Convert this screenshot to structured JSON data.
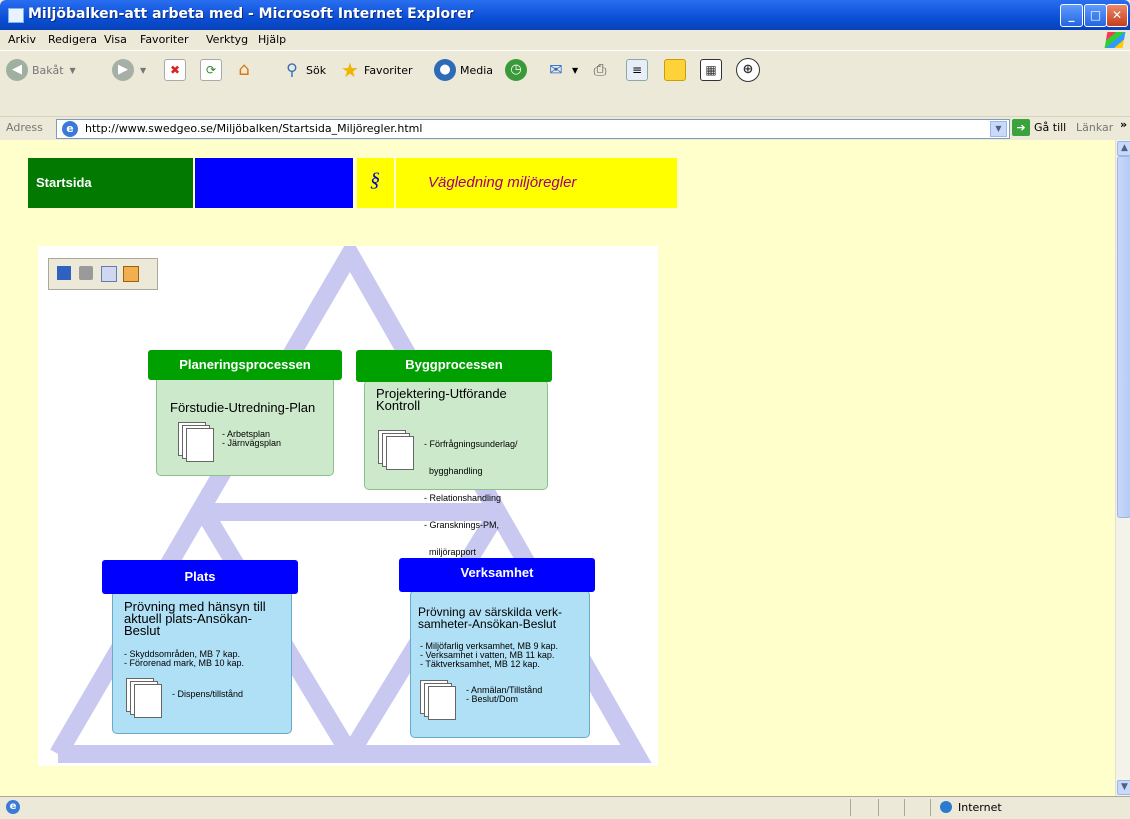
{
  "window": {
    "title": "Miljöbalken-att arbeta med - Microsoft Internet Explorer"
  },
  "menu": [
    "Arkiv",
    "Redigera",
    "Visa",
    "Favoriter",
    "Verktyg",
    "Hjälp"
  ],
  "toolbar": {
    "back": "Bakåt",
    "search": "Sök",
    "favorites": "Favoriter",
    "media": "Media"
  },
  "address": {
    "label": "Adress",
    "url": "http://www.swedgeo.se/Miljöbalken/Startsida_Miljöregler.html",
    "go": "Gå till",
    "links": "Länkar"
  },
  "status": {
    "zone": "Internet"
  },
  "nav": {
    "home": "Startsida",
    "paragraph": "§",
    "guide": "Vägledning miljöregler"
  },
  "colors": {
    "green": "#027a02",
    "blue": "#0000ff",
    "yellow": "#ffff00",
    "guide_text": "#a0007a"
  },
  "diagram": {
    "planering": {
      "header": "Planeringsprocessen",
      "title": "Förstudie-Utredning-Plan",
      "docs": [
        "- Arbetsplan",
        "- Järnvägsplan"
      ]
    },
    "bygg": {
      "header": "Byggprocessen",
      "title_1": "Projektering-Utförande",
      "title_2": "Kontroll",
      "docs": [
        "- Förfrågningsunderlag/",
        "  bygghandling",
        "- Relationshandling",
        "- Gransknings-PM,",
        "  miljörapport"
      ]
    },
    "plats": {
      "header": "Plats",
      "title_1": "Prövning med hänsyn till",
      "title_2": "aktuell plats-Ansökan-",
      "title_3": "Beslut",
      "items": [
        "- Skyddsområden, MB 7 kap.",
        "- Förorenad mark, MB 10 kap."
      ],
      "docs": [
        "- Dispens/tillstånd"
      ]
    },
    "verksamhet": {
      "header": "Verksamhet",
      "title_1": "Prövning av särskilda verk-",
      "title_2": "samheter-Ansökan-Beslut",
      "items": [
        "- Miljöfarlig verksamhet, MB 9 kap.",
        "- Verksamhet i vatten, MB 11 kap.",
        "- Täktverksamhet, MB 12 kap."
      ],
      "docs": [
        "- Anmälan/Tillstånd",
        "- Beslut/Dom"
      ]
    }
  }
}
